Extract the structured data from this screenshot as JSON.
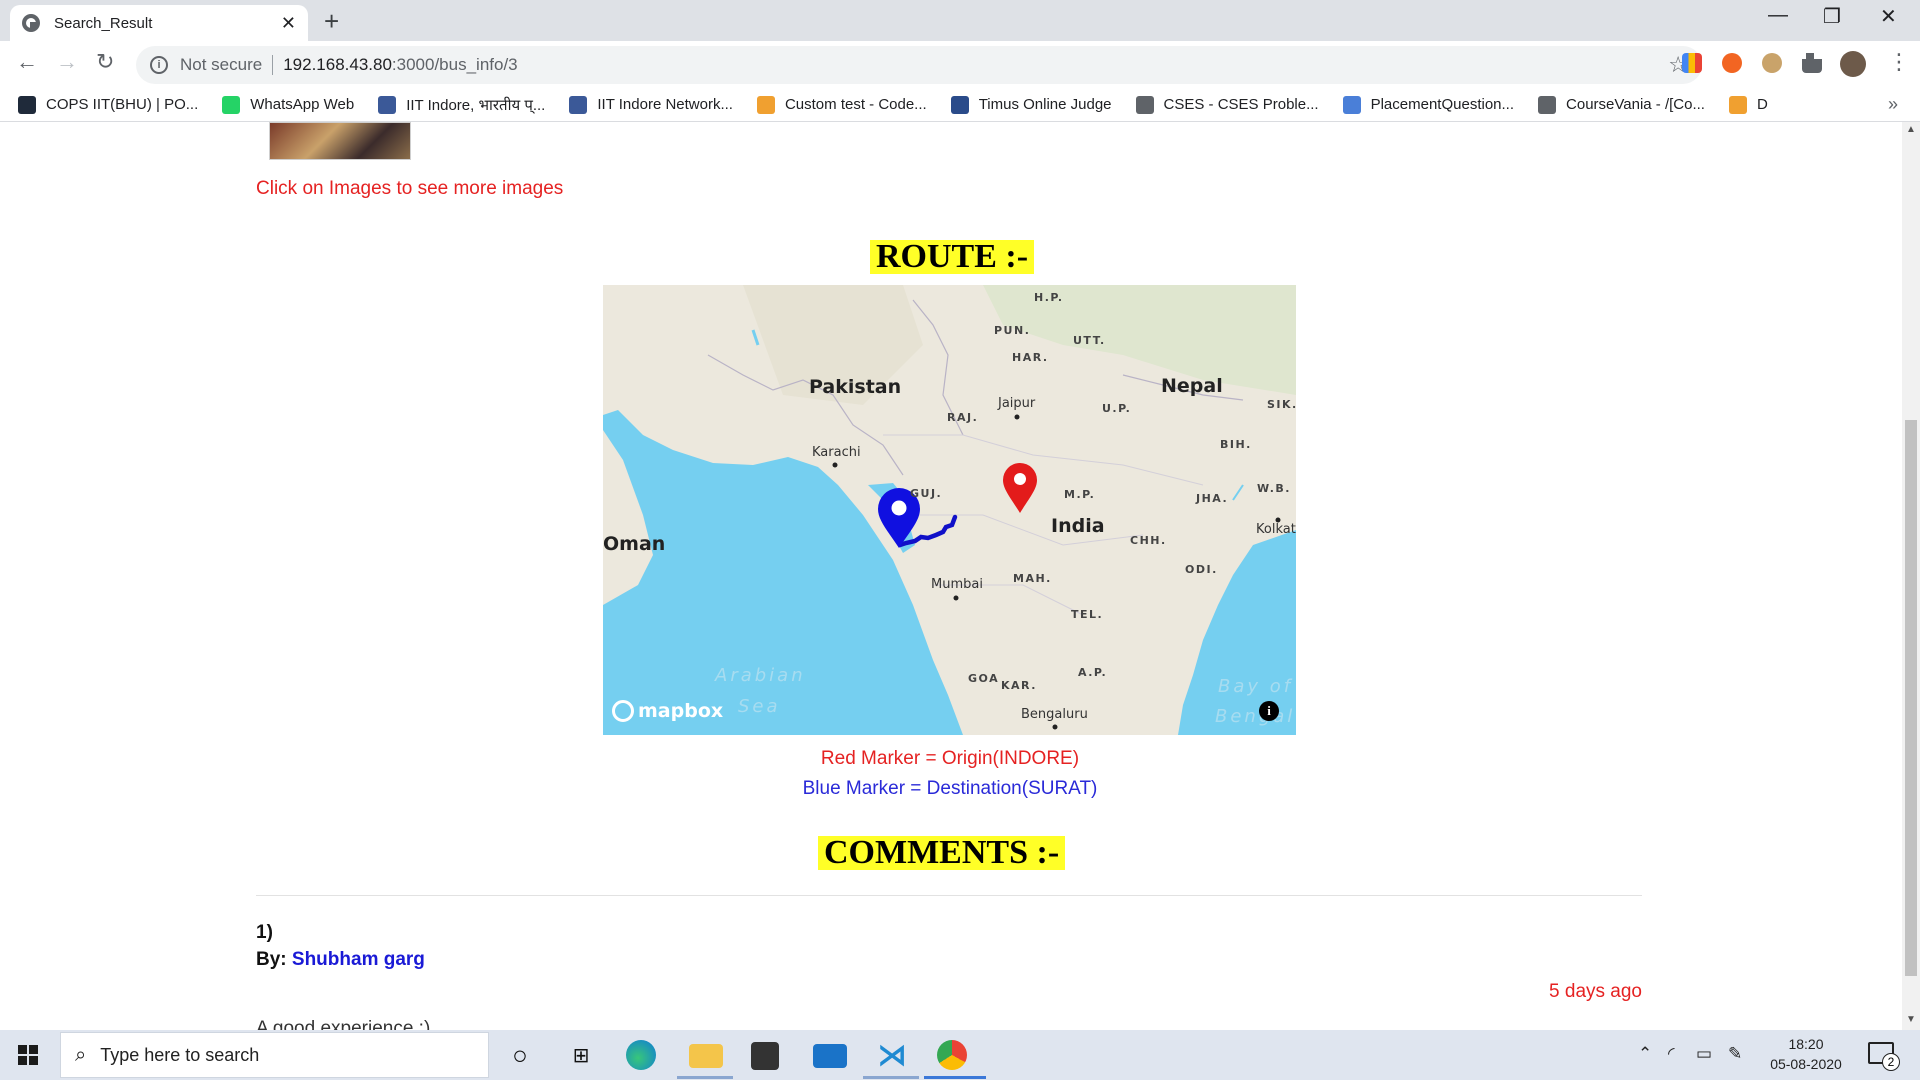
{
  "browser": {
    "tab_title": "Search_Result",
    "tab_close": "✕",
    "new_tab": "+",
    "url_security": "Not secure",
    "url_host": "192.168.43.80",
    "url_path": ":3000/bus_info/3",
    "window_controls": {
      "minimize": "—",
      "maximize": "❐",
      "close": "✕"
    }
  },
  "bookmarks": [
    {
      "label": "COPS IIT(BHU) | PO...",
      "color": "#1f2a3a"
    },
    {
      "label": "WhatsApp Web",
      "color": "#25d366"
    },
    {
      "label": "IIT Indore, भारतीय प्...",
      "color": "#3b5998"
    },
    {
      "label": "IIT Indore Network...",
      "color": "#3b5998"
    },
    {
      "label": "Custom test - Code...",
      "color": "#f0a030"
    },
    {
      "label": "Timus Online Judge",
      "color": "#2a4b8a"
    },
    {
      "label": "CSES - CSES Proble...",
      "color": "#5f6368"
    },
    {
      "label": "PlacementQuestion...",
      "color": "#4a7fd8"
    },
    {
      "label": "CourseVania - /[Co...",
      "color": "#5f6368"
    },
    {
      "label": "D",
      "color": "#f0a030"
    }
  ],
  "page": {
    "click_note": "Click on Images to see more images",
    "route_heading": "ROUTE :-",
    "comments_heading": "COMMENTS :-",
    "legend_origin": "Red Marker = Origin(INDORE)",
    "legend_destination": "Blue Marker = Destination(SURAT)",
    "comment": {
      "number": "1)",
      "by_label": "By:",
      "author": "Shubham garg",
      "time_ago": "5 days ago",
      "text": "A good experience :)"
    }
  },
  "map": {
    "countries": [
      "Pakistan",
      "Nepal",
      "India",
      "Oman"
    ],
    "states": [
      "H.P.",
      "PUN.",
      "UTT.",
      "HAR.",
      "RAJ.",
      "U.P.",
      "SIK.",
      "BIH.",
      "GUJ.",
      "M.P.",
      "JHA.",
      "W.B.",
      "CHH.",
      "ODI.",
      "MAH.",
      "TEL.",
      "A.P.",
      "GOA",
      "KAR."
    ],
    "cities": [
      "Jaipur",
      "Karachi",
      "Kolkat",
      "Mumbai",
      "Bengaluru"
    ],
    "seas": [
      "Arabian",
      "Sea",
      "Bay of",
      "Bengal"
    ],
    "attribution": "mapbox",
    "info_icon": "i",
    "origin_marker_color": "#e31b1b",
    "destination_marker_color": "#1010e0",
    "route_color": "#1010c8"
  },
  "taskbar": {
    "search_placeholder": "Type here to search",
    "time": "18:20",
    "date": "05-08-2020",
    "notification_count": "2"
  }
}
